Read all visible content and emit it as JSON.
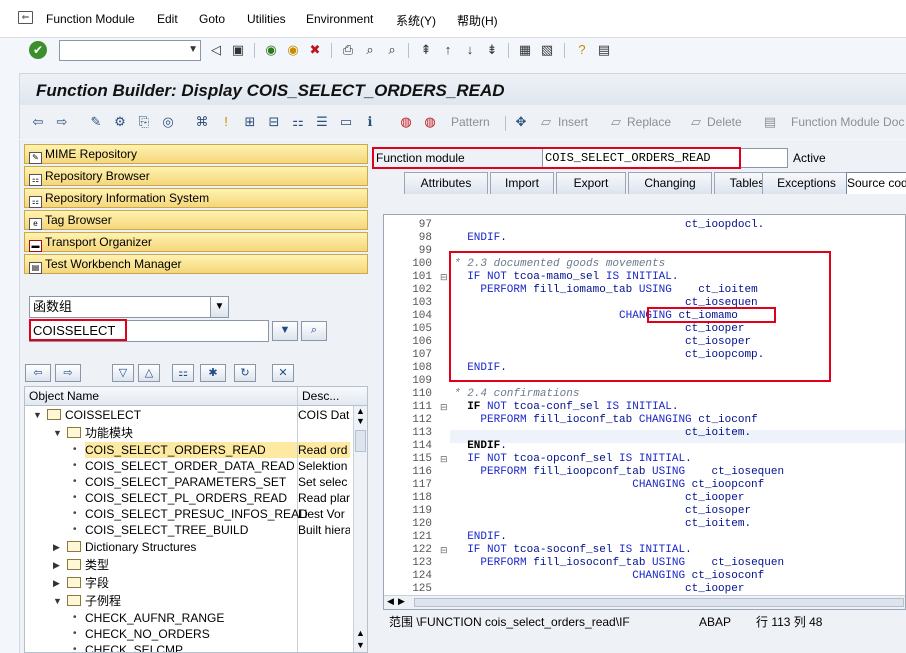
{
  "menu": [
    "Function Module",
    "Edit",
    "Goto",
    "Utilities",
    "Environment",
    "系统(Y)",
    "帮助(H)"
  ],
  "title": "Function Builder: Display COIS_SELECT_ORDERS_READ",
  "toolbar": {
    "pattern": "Pattern",
    "insert": "Insert",
    "replace": "Replace",
    "delete": "Delete",
    "fm_doc": "Function Module Doc"
  },
  "nav": [
    "MIME Repository",
    "Repository Browser",
    "Repository Information System",
    "Tag Browser",
    "Transport Organizer",
    "Test Workbench Manager"
  ],
  "object_type": "函数组",
  "object_name": "COISSELECT",
  "tree": {
    "col_name": "Object Name",
    "col_desc": "Desc...",
    "rows": [
      {
        "name": "COISSELECT",
        "desc": "COIS Dat"
      },
      {
        "name": "功能模块",
        "desc": ""
      },
      {
        "name": "COIS_SELECT_ORDERS_READ",
        "desc": "Read ord"
      },
      {
        "name": "COIS_SELECT_ORDER_DATA_READ",
        "desc": "Selektion"
      },
      {
        "name": "COIS_SELECT_PARAMETERS_SET",
        "desc": "Set selec"
      },
      {
        "name": "COIS_SELECT_PL_ORDERS_READ",
        "desc": "Read plar"
      },
      {
        "name": "COIS_SELECT_PRESUC_INFOS_READ",
        "desc": "Liest Vor"
      },
      {
        "name": "COIS_SELECT_TREE_BUILD",
        "desc": "Built hiera"
      },
      {
        "name": "Dictionary Structures",
        "desc": ""
      },
      {
        "name": "类型",
        "desc": ""
      },
      {
        "name": "字段",
        "desc": ""
      },
      {
        "name": "子例程",
        "desc": ""
      },
      {
        "name": "CHECK_AUFNR_RANGE",
        "desc": ""
      },
      {
        "name": "CHECK_NO_ORDERS",
        "desc": ""
      },
      {
        "name": "CHECK_SELCMP",
        "desc": ""
      }
    ]
  },
  "fm": {
    "label": "Function module",
    "value": "COIS_SELECT_ORDERS_READ",
    "status": "Active"
  },
  "tabs": [
    "Attributes",
    "Import",
    "Export",
    "Changing",
    "Tables",
    "Exceptions",
    "Source code"
  ],
  "code": {
    "line_numbers": [
      "97",
      "98",
      "99",
      "100",
      "101",
      "102",
      "103",
      "104",
      "105",
      "106",
      "107",
      "108",
      "109",
      "110",
      "111",
      "112",
      "113",
      "114",
      "115",
      "116",
      "117",
      "118",
      "119",
      "120",
      "121",
      "122",
      "123",
      "124",
      "125"
    ],
    "lines": [
      "                                   ct_ioopdocl.",
      "  ENDIF.",
      "",
      "* 2.3 documented goods movements",
      "  IF NOT tcoa-mamo_sel IS INITIAL.",
      "    PERFORM fill_iomamo_tab USING    ct_ioitem",
      "                                   ct_iosequen",
      "                         CHANGING ct_iomamo",
      "                                   ct_iooper",
      "                                   ct_iosoper",
      "                                   ct_ioopcomp.",
      "  ENDIF.",
      "",
      "* 2.4 confirmations",
      "  IF NOT tcoa-conf_sel IS INITIAL.",
      "    PERFORM fill_ioconf_tab CHANGING ct_ioconf",
      "                                   ct_ioitem.",
      "  ENDIF.",
      "  IF NOT tcoa-opconf_sel IS INITIAL.",
      "    PERFORM fill_ioopconf_tab USING    ct_iosequen",
      "                           CHANGING ct_ioopconf",
      "                                   ct_iooper",
      "                                   ct_iosoper",
      "                                   ct_ioitem.",
      "  ENDIF.",
      "  IF NOT tcoa-soconf_sel IS INITIAL.",
      "    PERFORM fill_iosoconf_tab USING    ct_iosequen",
      "                           CHANGING ct_iosoconf",
      "                                   ct_iooper"
    ]
  },
  "status": {
    "scope": "范围 \\FUNCTION cois_select_orders_read\\IF",
    "lang": "ABAP",
    "position": "行 113 列  48"
  }
}
